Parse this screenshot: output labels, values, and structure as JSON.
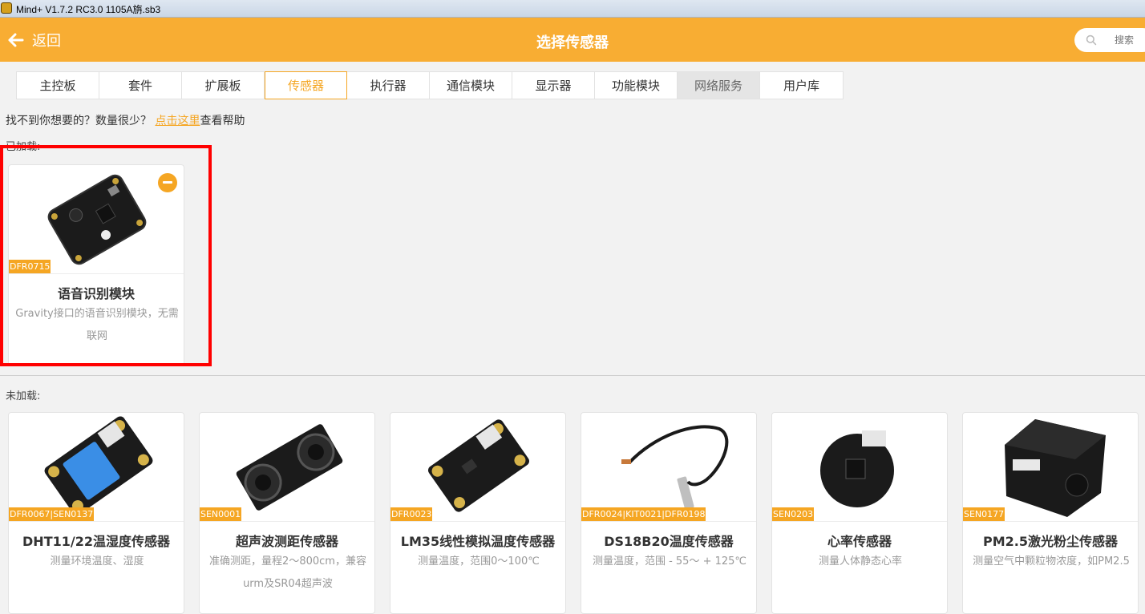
{
  "window": {
    "title": "Mind+ V1.7.2 RC3.0   1105A旃.sb3"
  },
  "header": {
    "back_label": "返回",
    "title": "选择传感器",
    "search_placeholder": "搜索"
  },
  "tabs": [
    {
      "label": "主控板",
      "state": "normal"
    },
    {
      "label": "套件",
      "state": "normal"
    },
    {
      "label": "扩展板",
      "state": "normal"
    },
    {
      "label": "传感器",
      "state": "active"
    },
    {
      "label": "执行器",
      "state": "normal"
    },
    {
      "label": "通信模块",
      "state": "normal"
    },
    {
      "label": "显示器",
      "state": "normal"
    },
    {
      "label": "功能模块",
      "state": "normal"
    },
    {
      "label": "网络服务",
      "state": "hover"
    },
    {
      "label": "用户库",
      "state": "normal"
    }
  ],
  "help": {
    "prefix": "找不到你想要的？数量很少？ ",
    "link": "点击这里",
    "suffix": "查看帮助"
  },
  "loaded": {
    "label": "已加载:",
    "items": [
      {
        "code": "DFR0715",
        "name": "语音识别模块",
        "desc": "Gravity接口的语音识别模块，无需联网",
        "image": "voice-recognition-board"
      }
    ]
  },
  "unloaded": {
    "label": "未加载:",
    "items": [
      {
        "code": "DFR0067|SEN0137",
        "name": "DHT11/22温湿度传感器",
        "desc": "测量环境温度、湿度",
        "image": "dht11-board"
      },
      {
        "code": "SEN0001",
        "name": "超声波测距传感器",
        "desc": "准确测距，量程2～800cm，兼容urm及SR04超声波",
        "image": "ultrasonic-board"
      },
      {
        "code": "DFR0023",
        "name": "LM35线性模拟温度传感器",
        "desc": "测量温度，范围0～100℃",
        "image": "lm35-board"
      },
      {
        "code": "DFR0024|KIT0021|DFR0198",
        "name": "DS18B20温度传感器",
        "desc": "测量温度，范围 - 55～ + 125℃",
        "image": "ds18b20-probe"
      },
      {
        "code": "SEN0203",
        "name": "心率传感器",
        "desc": "测量人体静态心率",
        "image": "heart-rate-board"
      },
      {
        "code": "SEN0177",
        "name": "PM2.5激光粉尘传感器",
        "desc": "测量空气中颗粒物浓度，如PM2.5",
        "image": "pm25-sensor"
      }
    ]
  },
  "colors": {
    "accent": "#f5a623",
    "topbar": "#f8ad33",
    "highlight": "#ff0000"
  }
}
